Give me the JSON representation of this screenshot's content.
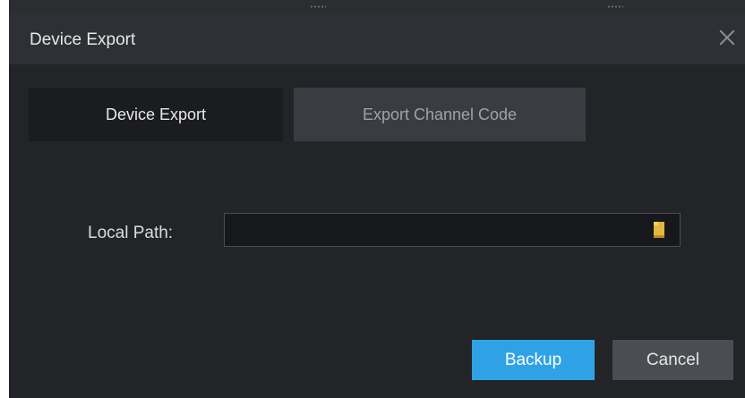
{
  "dialog": {
    "title": "Device Export"
  },
  "tabs": [
    {
      "label": "Device Export",
      "active": true
    },
    {
      "label": "Export Channel Code",
      "active": false
    }
  ],
  "form": {
    "local_path_label": "Local Path:",
    "local_path_value": "",
    "folder_icon": "folder-icon"
  },
  "buttons": {
    "backup_label": "Backup",
    "cancel_label": "Cancel"
  },
  "colors": {
    "dialog_bg": "#222428",
    "titlebar_bg": "#2e3035",
    "accent": "#2fa2e6",
    "folder": "#e3b63f"
  }
}
